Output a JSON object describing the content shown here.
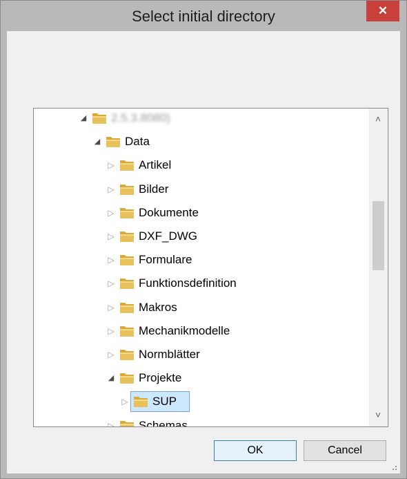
{
  "dialog": {
    "title": "Select initial directory",
    "close_glyph": "✕"
  },
  "tree": {
    "items": [
      {
        "label": "2.5.3.8080)",
        "depth": 0,
        "expanded": true,
        "blurred": true
      },
      {
        "label": "Data",
        "depth": 1,
        "expanded": true
      },
      {
        "label": "Artikel",
        "depth": 2,
        "expanded": false
      },
      {
        "label": "Bilder",
        "depth": 2,
        "expanded": false
      },
      {
        "label": "Dokumente",
        "depth": 2,
        "expanded": false
      },
      {
        "label": "DXF_DWG",
        "depth": 2,
        "expanded": false
      },
      {
        "label": "Formulare",
        "depth": 2,
        "expanded": false
      },
      {
        "label": "Funktionsdefinition",
        "depth": 2,
        "expanded": false
      },
      {
        "label": "Makros",
        "depth": 2,
        "expanded": false
      },
      {
        "label": "Mechanikmodelle",
        "depth": 2,
        "expanded": false
      },
      {
        "label": "Normblätter",
        "depth": 2,
        "expanded": false
      },
      {
        "label": "Projekte",
        "depth": 2,
        "expanded": true
      },
      {
        "label": "SUP",
        "depth": 3,
        "expanded": false,
        "selected": true
      },
      {
        "label": "Schemas",
        "depth": 2,
        "expanded": false
      }
    ],
    "scroll_up_glyph": "˄",
    "scroll_down_glyph": "˅"
  },
  "buttons": {
    "ok_label": "OK",
    "cancel_label": "Cancel"
  },
  "colors": {
    "close_button": "#c8403a",
    "selection_fill": "#cce8ff",
    "selection_border": "#7da2ce",
    "folder": "#e8c15c"
  }
}
